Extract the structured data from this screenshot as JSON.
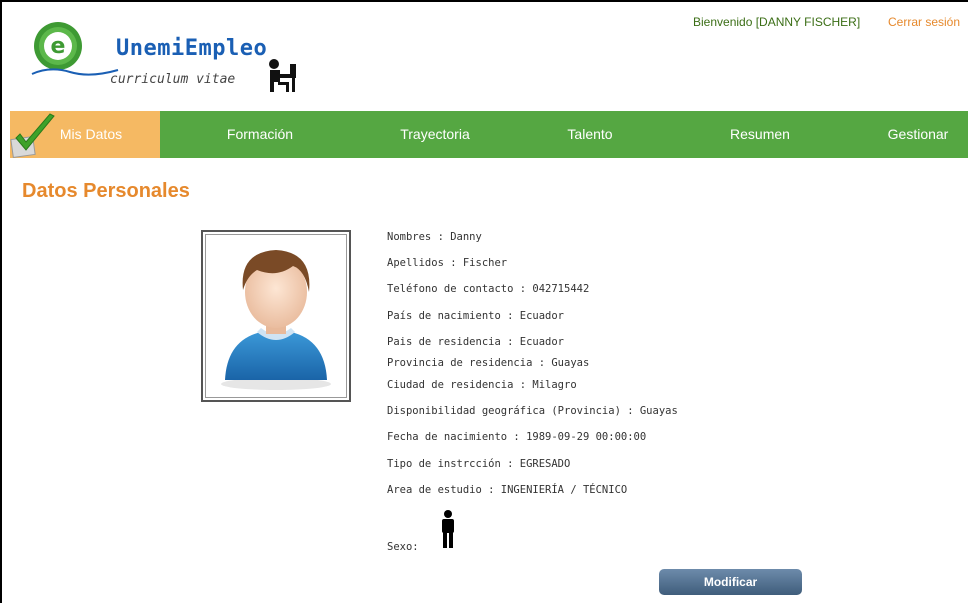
{
  "header": {
    "logo_title": "UnemiEmpleo",
    "logo_subtitle": "curriculum vitae",
    "welcome": "Bienvenido [DANNY FISCHER]",
    "logout": "Cerrar sesión"
  },
  "nav": {
    "items": [
      {
        "label": "Mis Datos",
        "active": true
      },
      {
        "label": "Formación",
        "active": false
      },
      {
        "label": "Trayectoria",
        "active": false
      },
      {
        "label": "Talento",
        "active": false
      },
      {
        "label": "Resumen",
        "active": false
      },
      {
        "label": "Gestionar",
        "active": false
      }
    ]
  },
  "section_title": "Datos Personales",
  "fields": [
    "Nombres : Danny",
    "Apellidos : Fischer",
    "Teléfono de contacto : 042715442",
    "País de nacimiento : Ecuador",
    "Pais de residencia : Ecuador",
    "Provincia de residencia : Guayas",
    "Ciudad de residencia : Milagro",
    "Disponibilidad geográfica (Provincia) : Guayas",
    "Fecha de nacimiento : 1989-09-29 00:00:00",
    "Tipo de instrcción : EGRESADO",
    "Area de estudio : INGENIERÍA / TÉCNICO",
    "Sexo:"
  ],
  "modify_button": "Modificar",
  "colors": {
    "nav_green": "#55a742",
    "nav_active": "#f5b963",
    "accent_orange": "#e6892d"
  }
}
